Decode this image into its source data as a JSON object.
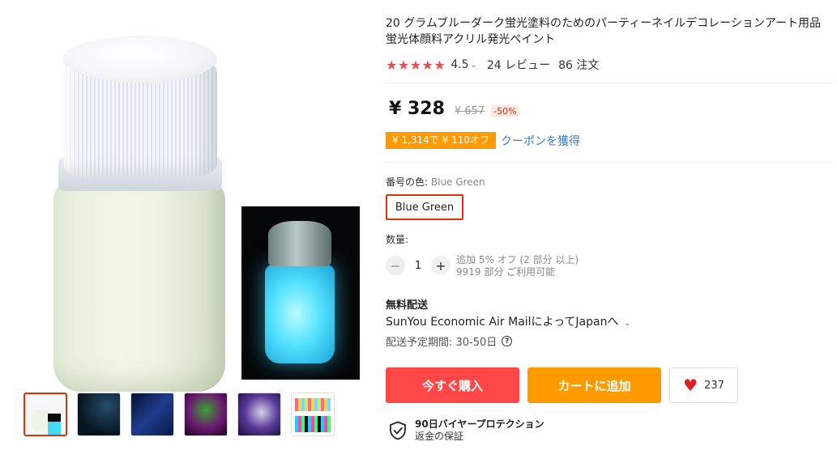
{
  "product": {
    "title": "20 グラムブルーダーク蛍光塗料のためのパーティーネイルデコレーションアート用品蛍光体顔料アクリル発光ペイント",
    "rating": "4.5",
    "stars": "★★★★★",
    "reviews": "24 レビュー",
    "orders": "86 注文"
  },
  "price": {
    "current": "¥ 328",
    "original": "¥ 657",
    "discount": "-50%"
  },
  "coupon": {
    "badge": "¥ 1,314で ¥ 110オフ",
    "link": "クーポンを獲得"
  },
  "variant": {
    "label": "番号の色:",
    "value": "Blue Green",
    "option": "Blue Green"
  },
  "quantity": {
    "label": "数量:",
    "value": "1",
    "minus": "−",
    "plus": "+",
    "note_line1": "追加 5% オフ (2 部分 以上)",
    "note_line2": "9919 部分 ご利用可能"
  },
  "shipping": {
    "title": "無料配送",
    "method": "SunYou Economic Air MailによってJapanへ",
    "chevron": "⌄",
    "time": "配送予定期間: 30-50日",
    "help": "?"
  },
  "actions": {
    "buy": "今すぐ購入",
    "cart": "カートに追加",
    "wishlist_count": "237"
  },
  "protection": {
    "title": "90日バイヤープロテクション",
    "subtitle": "返金の保証"
  },
  "gallery": {
    "thumbnail_count": 6,
    "active_index": 0
  },
  "colors": {
    "buy": "#ff4747",
    "cart": "#ff9a00",
    "accent_red": "#e62e04",
    "link_blue": "#2d7fc3"
  }
}
